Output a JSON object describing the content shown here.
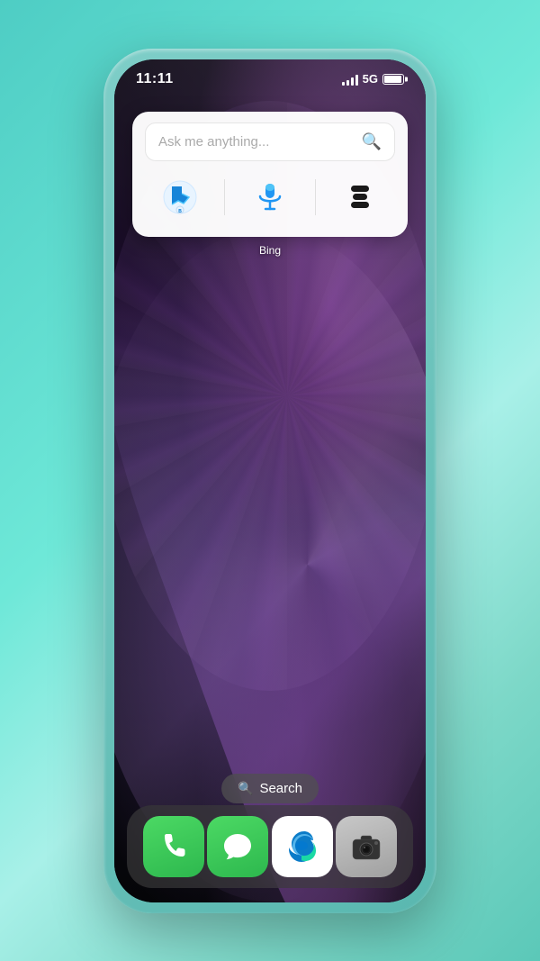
{
  "background": {
    "color": "#5abfb8"
  },
  "phone": {
    "frame_color": "#6ecec6"
  },
  "status_bar": {
    "time": "11:11",
    "network": "5G",
    "battery_level": 85
  },
  "bing_widget": {
    "search_placeholder": "Ask me anything...",
    "label": "Bing",
    "bing_btn_label": "bing",
    "mic_btn_label": "microphone",
    "profile_btn_label": "profile"
  },
  "dock_search": {
    "label": "Search",
    "icon": "search"
  },
  "app_dock": {
    "apps": [
      {
        "name": "Phone",
        "color1": "#4cd964",
        "color2": "#2db84e",
        "id": "phone"
      },
      {
        "name": "Messages",
        "color1": "#4cd964",
        "color2": "#2db84e",
        "id": "messages"
      },
      {
        "name": "Edge",
        "color1": "#ffffff",
        "color2": "#f0f0f0",
        "id": "edge"
      },
      {
        "name": "Camera",
        "color1": "#c8c8c8",
        "color2": "#909090",
        "id": "camera"
      }
    ]
  }
}
